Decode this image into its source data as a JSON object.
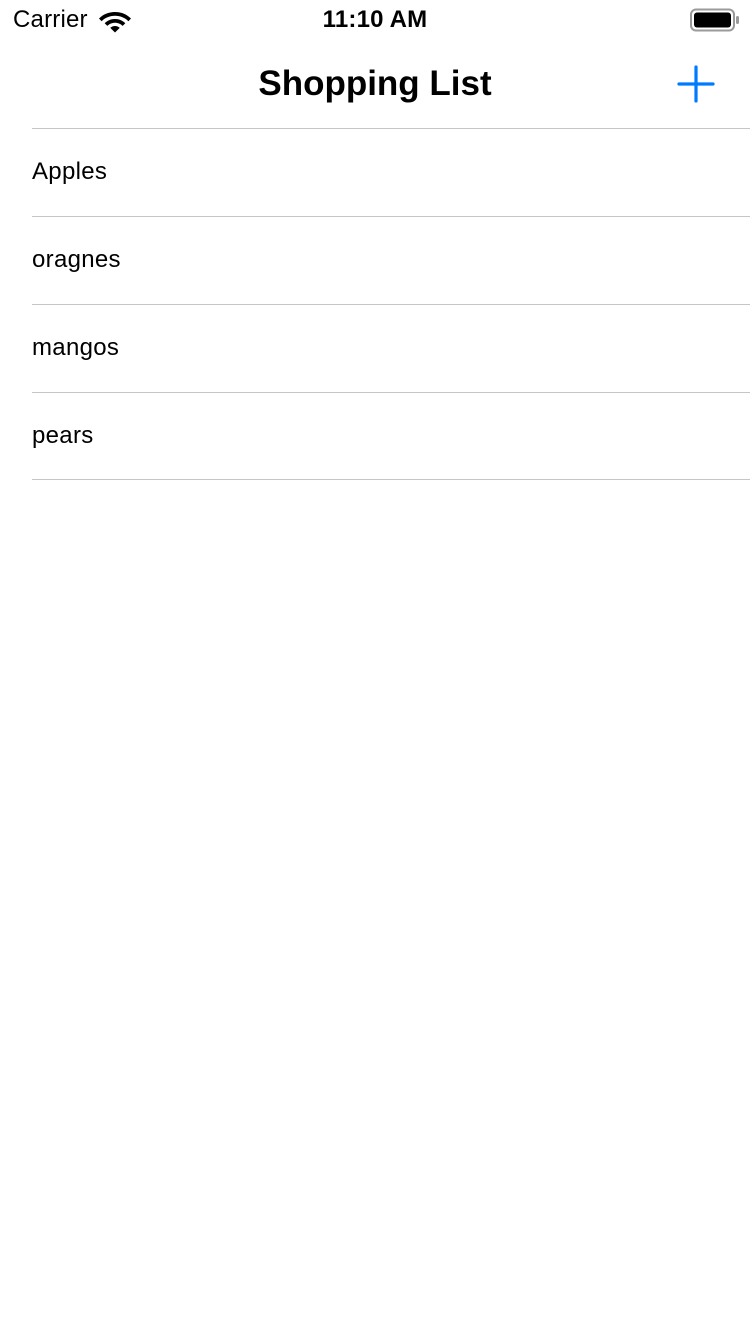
{
  "status_bar": {
    "carrier": "Carrier",
    "time": "11:10 AM",
    "wifi_icon": "wifi-icon",
    "battery_icon": "battery-full-icon"
  },
  "nav": {
    "title": "Shopping List",
    "add_icon": "plus-icon",
    "accent_color": "#007aff"
  },
  "list": {
    "items": [
      {
        "label": "Apples"
      },
      {
        "label": "oragnes"
      },
      {
        "label": "mangos"
      },
      {
        "label": "pears"
      }
    ]
  }
}
